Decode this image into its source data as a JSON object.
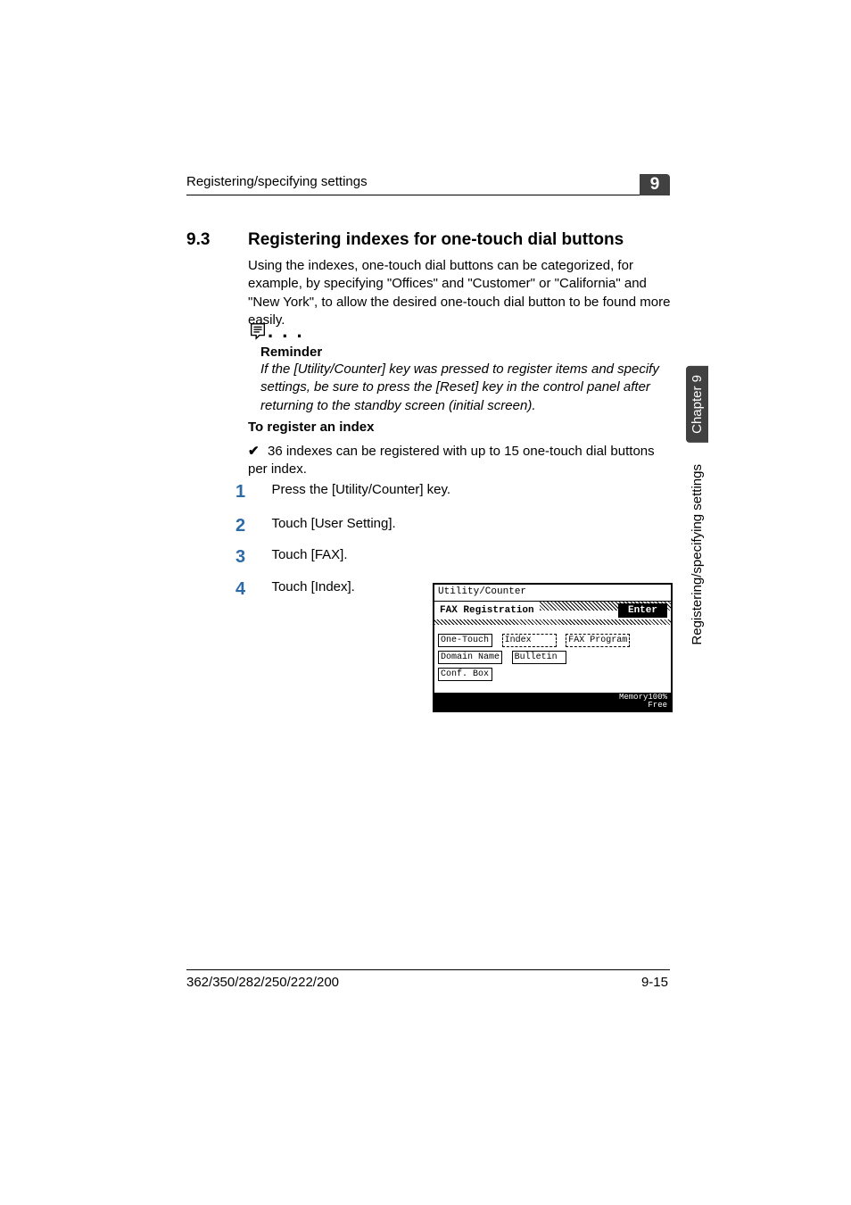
{
  "header": {
    "running_title": "Registering/specifying settings",
    "chapter_badge": "9"
  },
  "side_tab": {
    "chapter": "Chapter 9",
    "label": "Registering/specifying settings"
  },
  "section": {
    "number": "9.3",
    "title": "Registering indexes for one-touch dial buttons",
    "intro": "Using the indexes, one-touch dial buttons can be categorized, for example, by specifying \"Offices\" and \"Customer\" or \"California\" and \"New York\", to allow the desired one-touch dial button to be found more easily."
  },
  "reminder": {
    "heading": "Reminder",
    "body": "If the [Utility/Counter] key was pressed to register items and specify settings, be sure to press the [Reset] key in the control panel after returning to the standby screen (initial screen)."
  },
  "procedure": {
    "heading": "To register an index",
    "check_mark": "✔",
    "check_text": "36 indexes can be registered with up to 15 one-touch dial buttons per index.",
    "steps": [
      "Press the [Utility/Counter] key.",
      "Touch [User Setting].",
      "Touch [FAX].",
      "Touch [Index]."
    ]
  },
  "lcd": {
    "breadcrumb": "Utility/Counter",
    "title": "FAX Registration",
    "enter": "Enter",
    "buttons": {
      "one_touch": "One-Touch",
      "index": "Index",
      "fax_program": "FAX Program",
      "domain_name": "Domain Name",
      "bulletin": "Bulletin",
      "conf_box": "Conf. Box"
    },
    "footer_line1": "Memory",
    "footer_line2": "Free",
    "footer_value": "100%"
  },
  "footer": {
    "left": "362/350/282/250/222/200",
    "right": "9-15"
  }
}
